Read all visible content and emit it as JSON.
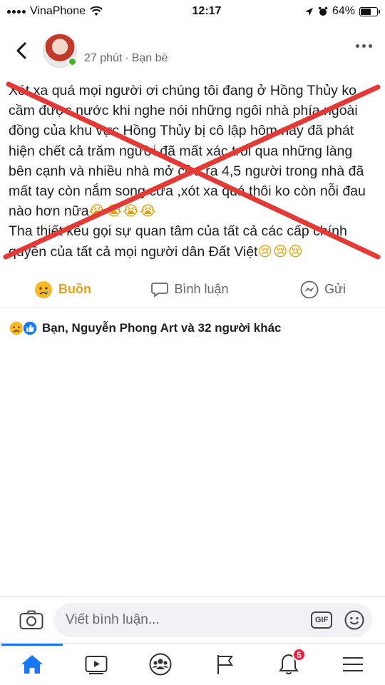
{
  "status_bar": {
    "carrier": "VinaPhone",
    "time": "12:17",
    "battery": "64%",
    "battery_level": 0.64
  },
  "post": {
    "meta_time": "27 phút",
    "meta_separator": "·",
    "meta_audience": "Bạn bè",
    "paragraph_1": "Xót xa quá mọi người ơi chúng tôi đang ở Hồng Thủy ko cầm được nước khi nghe nói những ngôi nhà phía ngoài đồng của khu vực Hồng Thủy bị cô lập hôm nay đã phát hiện chết cả trăm người đã mất xác trôi qua những làng bên cạnh và nhiều nhà mở cửa ra 4,5 người trong nhà đã mất tay còn nắm song cửa ,xót xa quá thôi ko còn nỗi đau nào hơn nữa",
    "paragraph_1_emojis": "😭😭😭😭",
    "paragraph_2": "Tha thiết kêu gọi sự quan tâm của tất cả các cấp chính quyền của tất cả mọi người dân Đất Việt",
    "paragraph_2_emojis": "😢😢😢"
  },
  "actions": {
    "sad_label": "Buồn",
    "comment_label": "Bình luận",
    "send_label": "Gửi"
  },
  "reactions": {
    "summary": "Bạn, Nguyễn Phong Art và 32 người khác"
  },
  "comment_bar": {
    "placeholder": "Viết bình luận...",
    "gif_label": "GIF"
  },
  "tab_bar": {
    "notifications_badge": "5"
  },
  "colors": {
    "brand_blue": "#1877f2",
    "sad_yellow": "#e0a11b",
    "cross_red": "#e53935",
    "badge_red": "#e41e3f"
  }
}
